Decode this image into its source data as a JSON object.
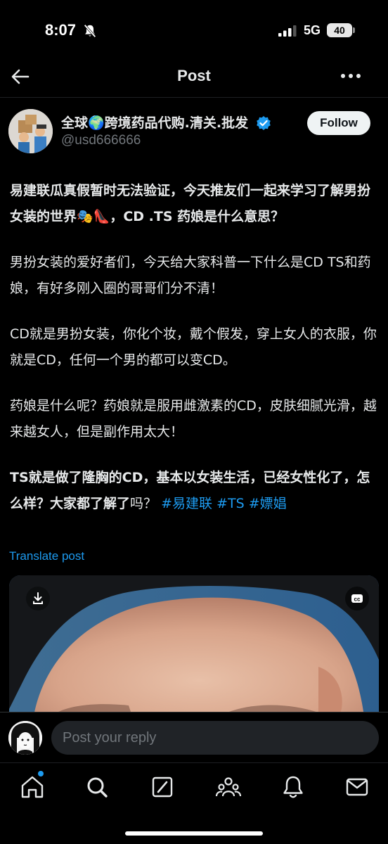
{
  "status_bar": {
    "time": "8:07",
    "network": "5G",
    "battery": "40"
  },
  "nav": {
    "title": "Post"
  },
  "author": {
    "display_name": "全球🌍跨境药品代购.清关.批发",
    "handle": "@usd666666",
    "verified": true,
    "follow_label": "Follow"
  },
  "post": {
    "p1_text": "易建联瓜真假暂时无法验证，今天推友们一起来学习了解男扮女装的世界🎭👠，CD .TS 药娘是什么意思？",
    "p2_text": "男扮女装的爱好者们，今天给大家科普一下什么是CD TS和药娘，有好多刚入圈的哥哥们分不清！",
    "p3_text": "CD就是男扮女装，你化个妆，戴个假发，穿上女人的衣服，你就是CD，任何一个男的都可以变CD。",
    "p4_text": "药娘是什么呢？药娘就是服用雌激素的CD，皮肤细腻光滑，越来越女人，但是副作用太大！",
    "p5_bold": "TS就是做了隆胸的CD，基本以女装生活，已经女性化了，怎么样？大家都了解了",
    "p5_plain": "吗？",
    "hashtags": [
      "#易建联",
      "#TS",
      "#嫖娼"
    ],
    "translate_label": "Translate post"
  },
  "media": {
    "type": "video",
    "cc_label": "cc"
  },
  "reply": {
    "placeholder": "Post your reply"
  },
  "tab_bar": {
    "items": [
      "home-icon",
      "search-icon",
      "grok-icon",
      "communities-icon",
      "notifications-icon",
      "messages-icon"
    ],
    "home_has_notification_dot": true
  },
  "colors": {
    "background": "#000000",
    "accent": "#1d9bf0",
    "text": "#e7e9ea",
    "muted": "#71767b"
  }
}
